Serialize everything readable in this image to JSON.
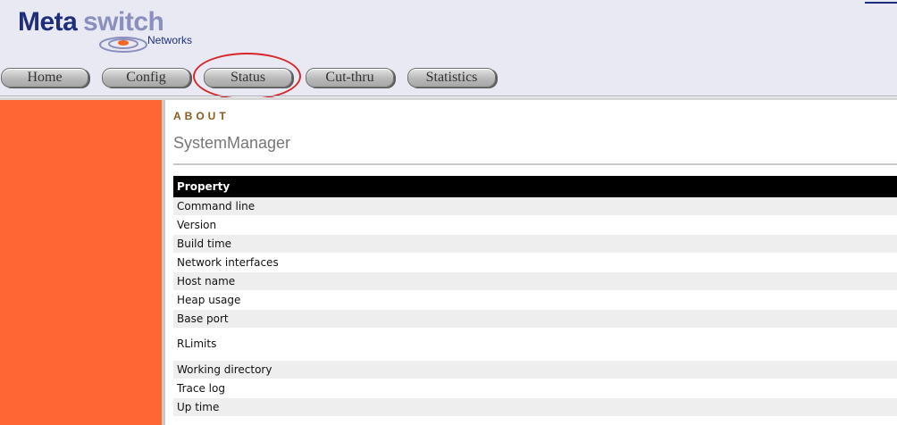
{
  "logo": {
    "part1": "Meta",
    "part2": "switch",
    "sub": "Networks"
  },
  "nav": {
    "tabs": [
      {
        "label": "Home"
      },
      {
        "label": "Config"
      },
      {
        "label": "Status"
      },
      {
        "label": "Cut-thru"
      },
      {
        "label": "Statistics"
      }
    ]
  },
  "colors": {
    "sidebar": "#ff6633",
    "header": "#e8e9f2",
    "accent": "#8b5a1e",
    "highlight": "#d8262b"
  },
  "content": {
    "section": "ABOUT",
    "title": "SystemManager",
    "table": {
      "header": "Property",
      "rows": [
        "Command line",
        "Version",
        "Build time",
        "Network interfaces",
        "Host name",
        "Heap usage",
        "Base port",
        "RLimits",
        "Working directory",
        "Trace log",
        "Up time"
      ]
    }
  }
}
